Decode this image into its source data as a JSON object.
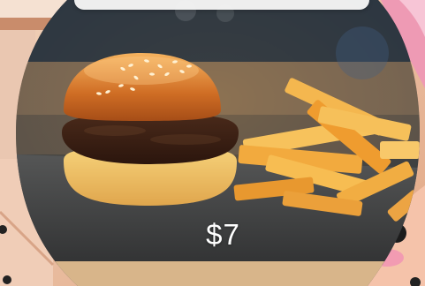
{
  "product": {
    "price": "$7",
    "image": "burger-and-fries-photo"
  },
  "colors": {
    "accent_pink": "#ee9ab4",
    "background_peach": "#e6b9a2",
    "price_text": "#ffffff"
  }
}
